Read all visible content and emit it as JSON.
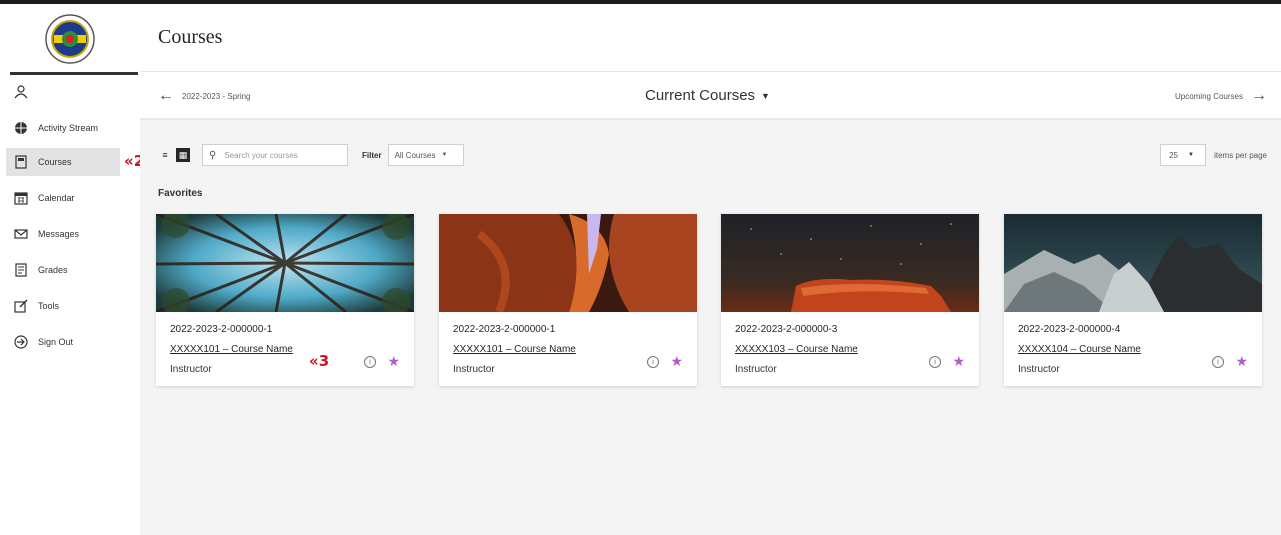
{
  "header": {
    "title": "Courses"
  },
  "sidebar": {
    "items": [
      {
        "label": "",
        "icon": "user-icon"
      },
      {
        "label": "Activity Stream",
        "icon": "globe-icon"
      },
      {
        "label": "Courses",
        "icon": "book-icon",
        "active": true
      },
      {
        "label": "Calendar",
        "icon": "calendar-icon"
      },
      {
        "label": "Messages",
        "icon": "envelope-icon"
      },
      {
        "label": "Grades",
        "icon": "grades-icon"
      },
      {
        "label": "Tools",
        "icon": "tools-icon"
      },
      {
        "label": "Sign Out",
        "icon": "sign-out-icon"
      }
    ],
    "marker_courses": "«2"
  },
  "termbar": {
    "previous": "2022-2023 - Spring",
    "current": "Current Courses",
    "next": "Upcoming Courses"
  },
  "toolbar": {
    "search_placeholder": "Search your courses",
    "filter_label": "Filter",
    "filter_value": "All Courses",
    "per_page_value": "25",
    "per_page_label": "items per page"
  },
  "favorites": {
    "title": "Favorites",
    "courses": [
      {
        "code": "2022-2023-2-000000-1",
        "name": "XXXXX101 – Course Name",
        "role": "Instructor"
      },
      {
        "code": "2022-2023-2-000000-1",
        "name": "XXXXX101 – Course Name",
        "role": "Instructor"
      },
      {
        "code": "2022-2023-2-000000-3",
        "name": "XXXXX103 – Course Name",
        "role": "Instructor"
      },
      {
        "code": "2022-2023-2-000000-4",
        "name": "XXXXX104 – Course Name",
        "role": "Instructor"
      }
    ],
    "marker_course_name": "«3"
  },
  "colors": {
    "accent_star": "#b35bcc",
    "marker": "#c8141e",
    "active_nav": "#e3e3e3"
  }
}
